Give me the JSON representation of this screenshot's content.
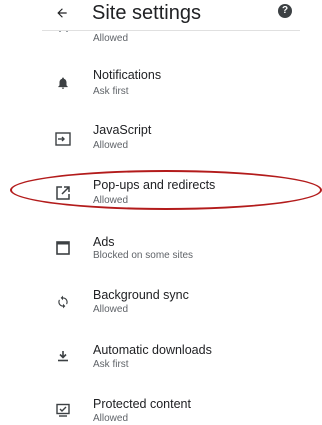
{
  "header": {
    "back_icon": "arrow-back-icon",
    "title": "Site settings",
    "help_icon": "help-icon",
    "help_glyph": "?"
  },
  "partial_row": {
    "subtitle": "Allowed"
  },
  "items": [
    {
      "id": "notifications",
      "icon": "bell-icon",
      "title": "Notifications",
      "subtitle": "Ask first"
    },
    {
      "id": "javascript",
      "icon": "javascript-icon",
      "title": "JavaScript",
      "subtitle": "Allowed"
    },
    {
      "id": "popups",
      "icon": "popup-redirect-icon",
      "title": "Pop-ups and redirects",
      "subtitle": "Allowed"
    },
    {
      "id": "ads",
      "icon": "ads-icon",
      "title": "Ads",
      "subtitle": "Blocked on some sites"
    },
    {
      "id": "background-sync",
      "icon": "sync-icon",
      "title": "Background sync",
      "subtitle": "Allowed"
    },
    {
      "id": "automatic-downloads",
      "icon": "download-icon",
      "title": "Automatic downloads",
      "subtitle": "Ask first"
    },
    {
      "id": "protected-content",
      "icon": "protected-content-icon",
      "title": "Protected content",
      "subtitle": "Allowed"
    }
  ],
  "colors": {
    "icon": "#3c4043",
    "title": "#202124",
    "subtitle": "#5f6368",
    "highlight_ellipse": "#b31b1b"
  }
}
